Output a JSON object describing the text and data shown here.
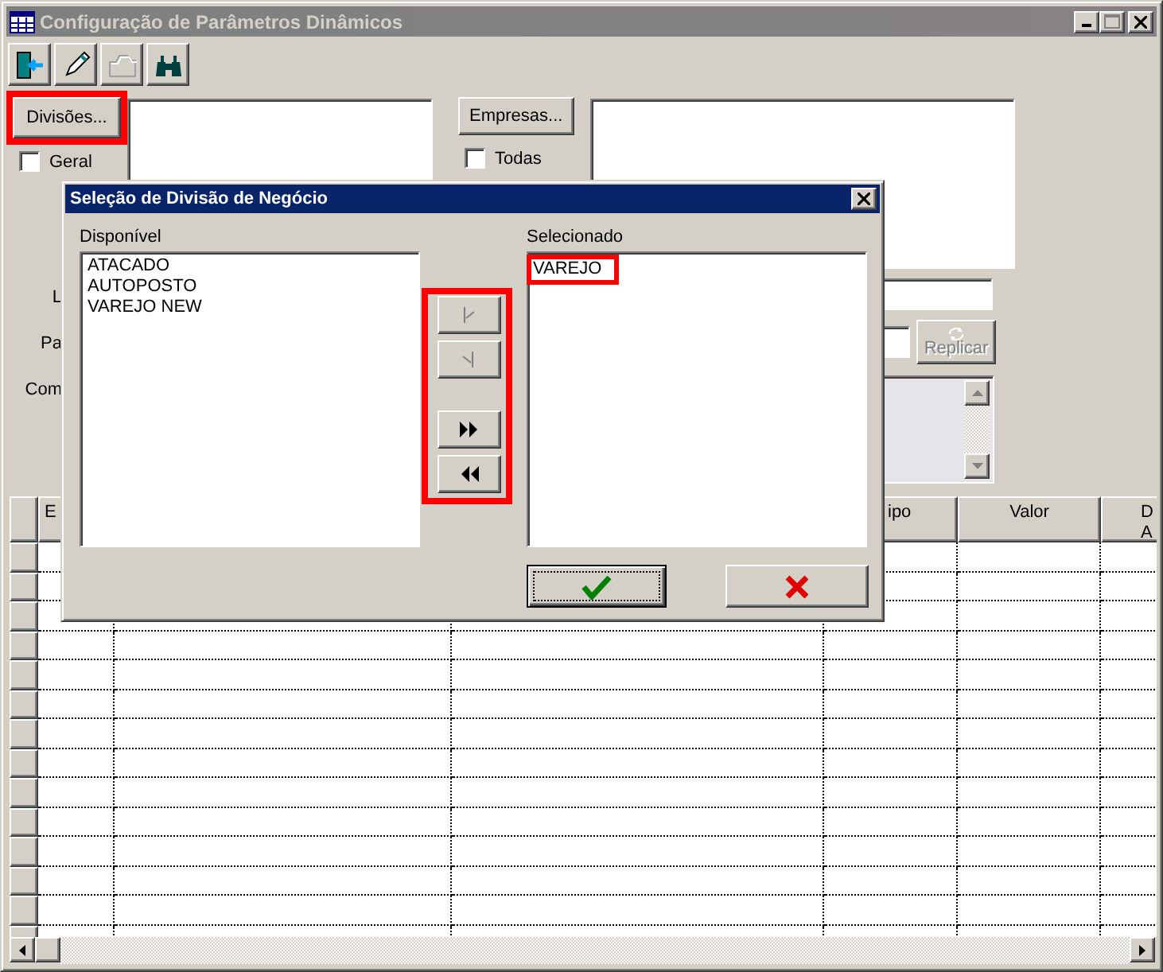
{
  "window": {
    "title": "Configuração de Parâmetros Dinâmicos"
  },
  "toolbar": [
    {
      "kind": "exit",
      "disabled": false
    },
    {
      "kind": "edit",
      "disabled": false
    },
    {
      "kind": "folder",
      "disabled": true
    },
    {
      "kind": "find",
      "disabled": false
    }
  ],
  "divisions": {
    "button": "Divisões...",
    "highlighted": true,
    "all_checkbox": {
      "label": "Geral",
      "checked": false
    }
  },
  "companies": {
    "button": "Empresas...",
    "highlighted": false,
    "all_checkbox": {
      "label": "Todas",
      "checked": false
    }
  },
  "field_labels": [
    "L",
    "Pa",
    "Com"
  ],
  "replicate_button": {
    "label": "Replicar",
    "disabled": true
  },
  "table": {
    "columns": [
      {
        "label": "E"
      },
      {
        "label": "ipo"
      },
      {
        "label": "Valor"
      },
      {
        "label": "D\nA"
      }
    ]
  },
  "dialog": {
    "title": "Seleção de Divisão de Negócio",
    "available": {
      "label": "Disponível",
      "items": [
        {
          "text": "ATACADO",
          "highlighted": false
        },
        {
          "text": "AUTOPOSTO",
          "highlighted": false
        },
        {
          "text": "VAREJO NEW",
          "highlighted": false
        }
      ]
    },
    "chosen": {
      "label": "Selecionado",
      "items": [
        {
          "text": "VAREJO",
          "highlighted": true
        }
      ]
    },
    "move_buttons": {
      "highlighted": true,
      "buttons": [
        {
          "kind": "add",
          "disabled": true
        },
        {
          "kind": "remove",
          "disabled": true
        },
        {
          "kind": "add_all",
          "disabled": false
        },
        {
          "kind": "remove_all",
          "disabled": false
        }
      ]
    },
    "action_buttons": [
      {
        "kind": "confirm",
        "default": true
      },
      {
        "kind": "cancel",
        "default": false
      }
    ]
  }
}
